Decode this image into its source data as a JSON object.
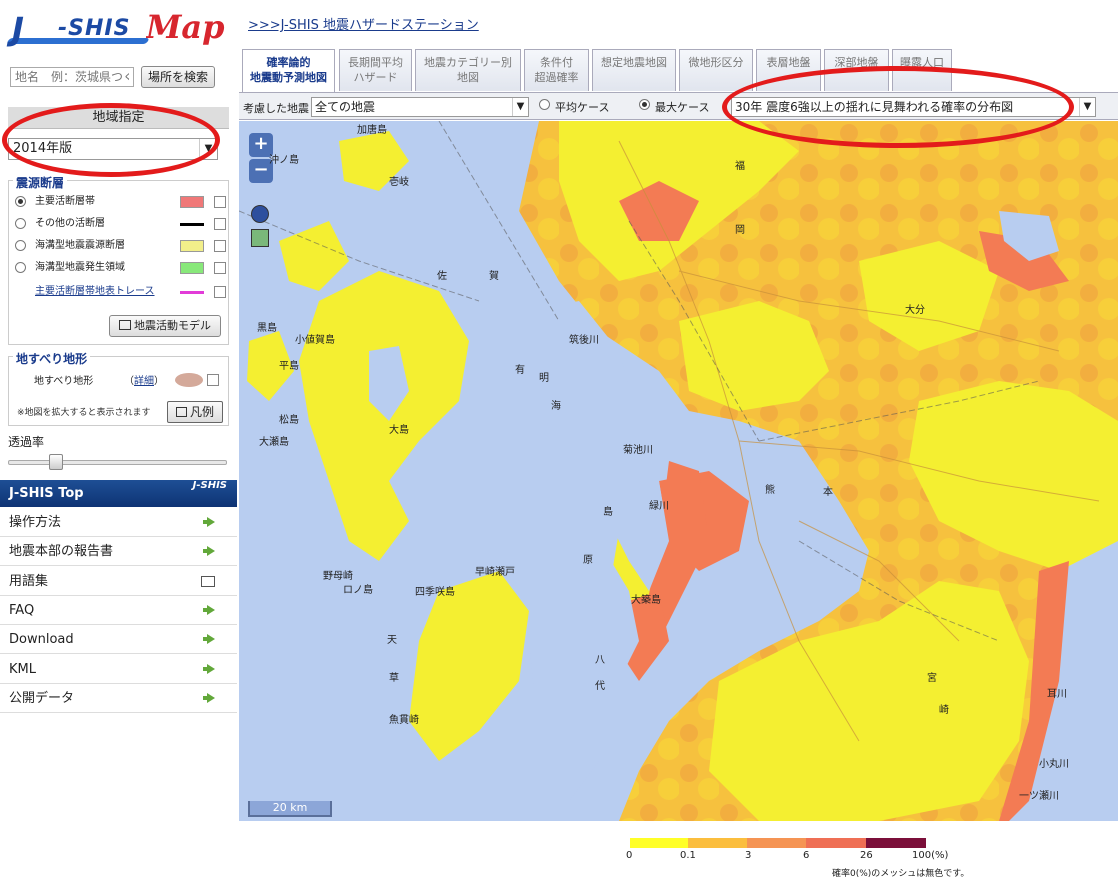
{
  "header": {
    "logo_text_j": "J",
    "logo_text_shis": "-SHIS",
    "logo_text_map": "Map",
    "top_link": ">>>J-SHIS 地震ハザードステーション"
  },
  "search": {
    "placeholder": "地名　例：茨城県つくば",
    "button": "場所を検索"
  },
  "region": {
    "heading": "地域指定",
    "version": "2014年版"
  },
  "faults": {
    "title": "震源断層",
    "items": [
      {
        "label": "主要活断層帯",
        "selected": true,
        "swatch": "#f07878"
      },
      {
        "label": "その他の活断層",
        "selected": false,
        "swatch": "#000000"
      },
      {
        "label": "海溝型地震震源断層",
        "selected": false,
        "swatch": "#f2ef8a"
      },
      {
        "label": "海溝型地震発生領域",
        "selected": false,
        "swatch": "#88e87a"
      },
      {
        "label": "主要活断層帯地表トレース",
        "selected": false,
        "swatch": "#e23cd8"
      }
    ],
    "model_button": "地震活動モデル"
  },
  "landslide": {
    "title": "地すべり地形",
    "label": "地すべり地形",
    "detail_open": "（",
    "detail": "詳細",
    "detail_close": "）",
    "note": "※地図を拡大すると表示されます",
    "legend_button": "凡例"
  },
  "opacity": {
    "label": "透過率",
    "value_fraction": 0.2
  },
  "jshis_top": {
    "title": "J-SHIS Top",
    "mini_logo": "J-SHIS",
    "items": [
      {
        "label": "操作方法",
        "icon": "arrow-right-icon"
      },
      {
        "label": "地震本部の報告書",
        "icon": "arrow-right-icon"
      },
      {
        "label": "用語集",
        "icon": "book-icon"
      },
      {
        "label": "FAQ",
        "icon": "arrow-right-icon"
      },
      {
        "label": "Download",
        "icon": "arrow-right-icon"
      },
      {
        "label": "KML",
        "icon": "arrow-right-icon"
      },
      {
        "label": "公開データ",
        "icon": "arrow-right-icon"
      }
    ]
  },
  "tabs": [
    {
      "line1": "確率論的",
      "line2": "地震動予測地図",
      "active": true
    },
    {
      "line1": "長期間平均",
      "line2": "ハザード",
      "active": false
    },
    {
      "line1": "地震カテゴリー別",
      "line2": "地図",
      "active": false
    },
    {
      "line1": "条件付",
      "line2": "超過確率",
      "active": false
    },
    {
      "line1": "想定地震地図",
      "line2": "",
      "active": false
    },
    {
      "line1": "微地形区分",
      "line2": "",
      "active": false
    },
    {
      "line1": "表層地盤",
      "line2": "",
      "active": false
    },
    {
      "line1": "深部地盤",
      "line2": "",
      "active": false
    },
    {
      "line1": "曝露人口",
      "line2": "",
      "active": false
    }
  ],
  "toolbar": {
    "considered_label": "考慮した地震",
    "considered_value": "全ての地震",
    "avg_case": "平均ケース",
    "max_case": "最大ケース",
    "selected_case": "max",
    "map_type": "30年 震度6強以上の揺れに見舞われる確率の分布図"
  },
  "map": {
    "zoom_in": "+",
    "zoom_out": "−",
    "scale": "20 km",
    "places": [
      {
        "text": "加唐島"
      },
      {
        "text": "沖ノ島"
      },
      {
        "text": "壱岐"
      },
      {
        "text": "小値賀島"
      },
      {
        "text": "黒島"
      },
      {
        "text": "平島"
      },
      {
        "text": "松島"
      },
      {
        "text": "大瀬島"
      },
      {
        "text": "大島"
      },
      {
        "text": "野母崎"
      },
      {
        "text": "ロノ島"
      },
      {
        "text": "四季咲島"
      },
      {
        "text": "天"
      },
      {
        "text": "草"
      },
      {
        "text": "魚貫崎"
      },
      {
        "text": "有"
      },
      {
        "text": "明"
      },
      {
        "text": "海"
      },
      {
        "text": "筑後川"
      },
      {
        "text": "菊池川"
      },
      {
        "text": "緑川"
      },
      {
        "text": "島"
      },
      {
        "text": "原"
      },
      {
        "text": "早崎瀬戸"
      },
      {
        "text": "八"
      },
      {
        "text": "代"
      },
      {
        "text": "大築島"
      },
      {
        "text": "大分"
      },
      {
        "text": "本"
      },
      {
        "text": "熊"
      },
      {
        "text": "宮"
      },
      {
        "text": "崎"
      },
      {
        "text": "福"
      },
      {
        "text": "岡"
      },
      {
        "text": "佐"
      },
      {
        "text": "賀"
      },
      {
        "text": "耳川"
      },
      {
        "text": "小丸川"
      },
      {
        "text": "一ツ瀬川"
      }
    ]
  },
  "legend": {
    "ticks": [
      "0",
      "0.1",
      "3",
      "6",
      "26",
      "100(%)"
    ],
    "colors": [
      "#ffff28",
      "#fbbe3e",
      "#f59454",
      "#ef6f55",
      "#7b0f3a"
    ],
    "note": "確率0(%)のメッシュは無色です。"
  },
  "colors": {
    "sea": "#b8cdf0",
    "low": "#f4ef31",
    "mid": "#f8b53c",
    "high": "#f37b54",
    "annotation": "#e31b1b"
  }
}
